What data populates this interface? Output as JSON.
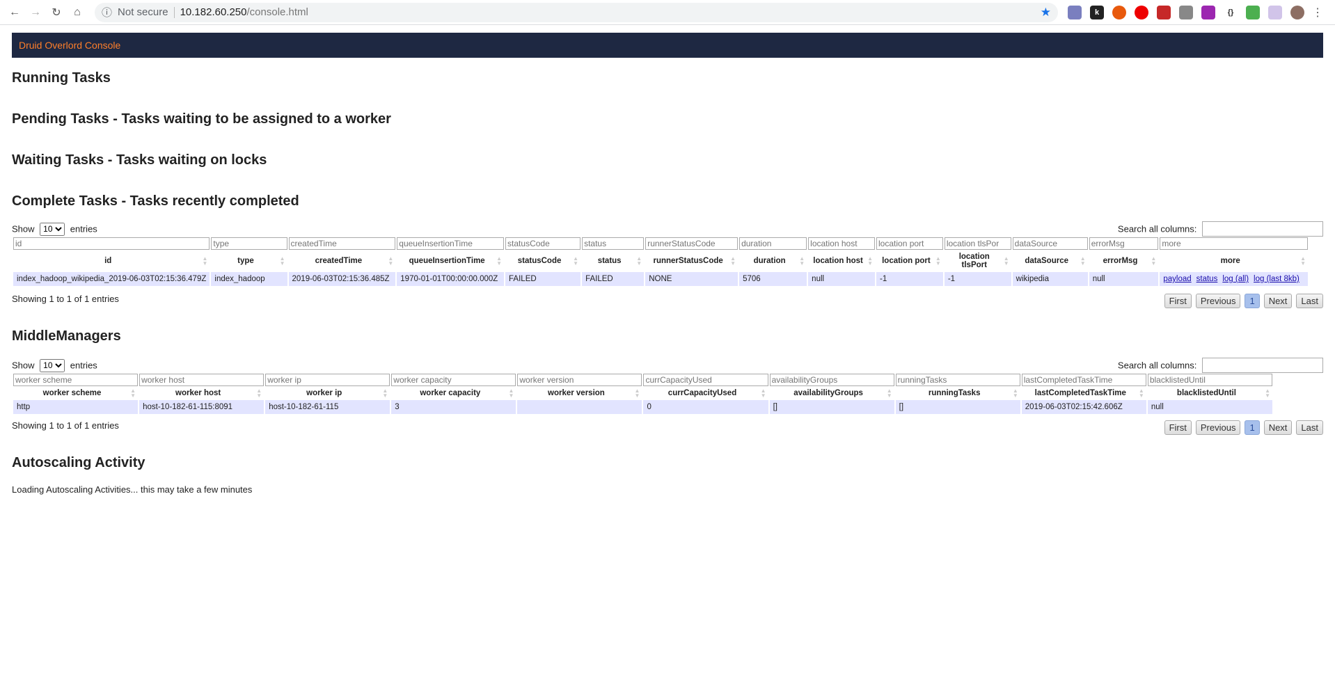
{
  "browser": {
    "security_label": "Not secure",
    "url_host": "10.182.60.250",
    "url_path": "/console.html"
  },
  "banner": {
    "title": "Druid Overlord Console"
  },
  "sections": {
    "running": "Running Tasks",
    "pending": "Pending Tasks - Tasks waiting to be assigned to a worker",
    "waiting": "Waiting Tasks - Tasks waiting on locks",
    "complete": "Complete Tasks - Tasks recently completed",
    "middlemanagers": "MiddleManagers",
    "autoscaling": "Autoscaling Activity"
  },
  "common": {
    "show": "Show",
    "entries": "entries",
    "page_size": "10",
    "search_label": "Search all columns:",
    "pager": {
      "first": "First",
      "previous": "Previous",
      "current": "1",
      "next": "Next",
      "last": "Last"
    }
  },
  "complete_tasks": {
    "columns": [
      "id",
      "type",
      "createdTime",
      "queueInsertionTime",
      "statusCode",
      "status",
      "runnerStatusCode",
      "duration",
      "location host",
      "location port",
      "location tlsPort",
      "dataSource",
      "errorMsg",
      "more"
    ],
    "filter_placeholders": [
      "id",
      "type",
      "createdTime",
      "queueInsertionTime",
      "statusCode",
      "status",
      "runnerStatusCode",
      "duration",
      "location host",
      "location port",
      "location tlsPor",
      "dataSource",
      "errorMsg",
      "more"
    ],
    "row": [
      "index_hadoop_wikipedia_2019-06-03T02:15:36.479Z",
      "index_hadoop",
      "2019-06-03T02:15:36.485Z",
      "1970-01-01T00:00:00.000Z",
      "FAILED",
      "FAILED",
      "NONE",
      "5706",
      "null",
      "-1",
      "-1",
      "wikipedia",
      "null"
    ],
    "links": [
      "payload",
      "status",
      "log (all)",
      "log (last 8kb)"
    ],
    "info": "Showing 1 to 1 of 1 entries"
  },
  "middle_managers": {
    "columns": [
      "worker scheme",
      "worker host",
      "worker ip",
      "worker capacity",
      "worker version",
      "currCapacityUsed",
      "availabilityGroups",
      "runningTasks",
      "lastCompletedTaskTime",
      "blacklistedUntil"
    ],
    "filter_placeholders": [
      "worker scheme",
      "worker host",
      "worker ip",
      "worker capacity",
      "worker version",
      "currCapacityUsed",
      "availabilityGroups",
      "runningTasks",
      "lastCompletedTaskTime",
      "blacklistedUntil"
    ],
    "row": [
      "http",
      "host-10-182-61-115:8091",
      "host-10-182-61-115",
      "3",
      "",
      "0",
      "[]",
      "[]",
      "2019-06-03T02:15:42.606Z",
      "null"
    ],
    "info": "Showing 1 to 1 of 1 entries"
  },
  "autoscaling": {
    "loading": "Loading Autoscaling Activities... this may take a few minutes"
  }
}
